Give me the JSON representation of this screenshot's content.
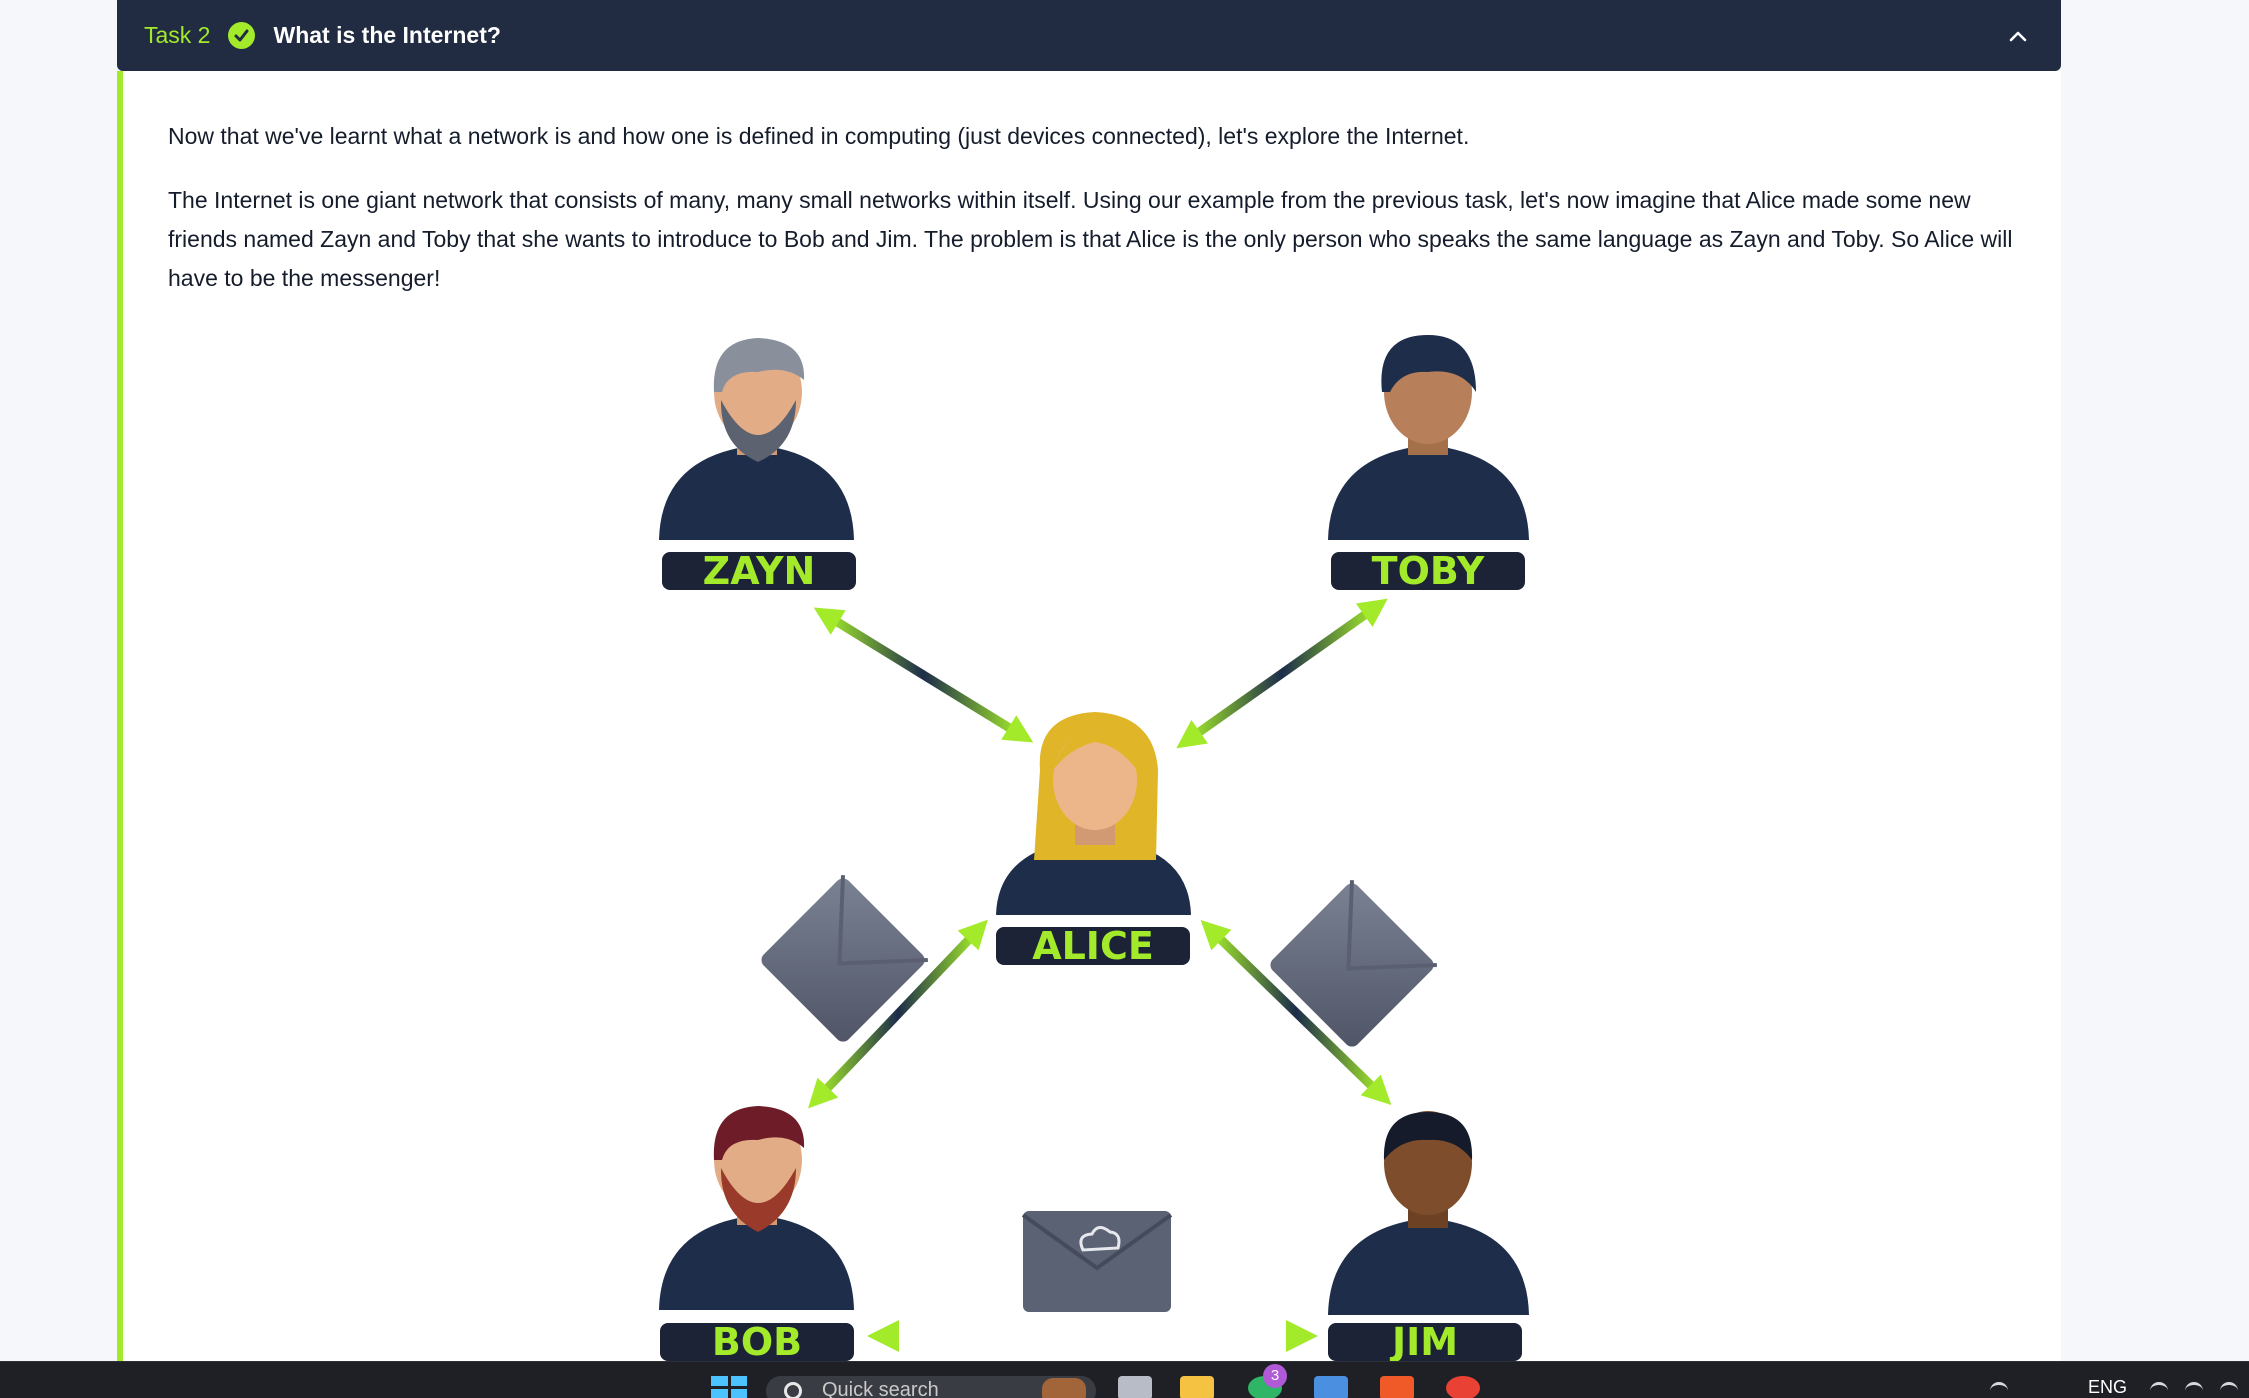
{
  "task": {
    "number_label": "Task 2",
    "title": "What is the Internet?"
  },
  "content": {
    "paragraph_1": "Now that we've learnt what a network is and how one is defined in computing (just devices connected), let's explore the Internet.",
    "paragraph_2": "The Internet is one giant network that consists of many, many small networks within itself. Using our example from the previous task, let's now imagine that Alice made some new friends named Zayn and Toby that she wants to introduce to Bob and Jim. The problem is that Alice is the only person who speaks the same language as Zayn and Toby. So Alice will have to be the messenger!"
  },
  "diagram": {
    "people": {
      "zayn": "ZAYN",
      "toby": "TOBY",
      "alice": "ALICE",
      "bob": "BOB",
      "jim": "JIM"
    }
  },
  "taskbar": {
    "search_placeholder": "Quick search",
    "notification_count": "3",
    "language": "ENG"
  },
  "colors": {
    "accent": "#a3ea2a",
    "header_bg": "#212c42",
    "label_bg": "#1c2336"
  }
}
